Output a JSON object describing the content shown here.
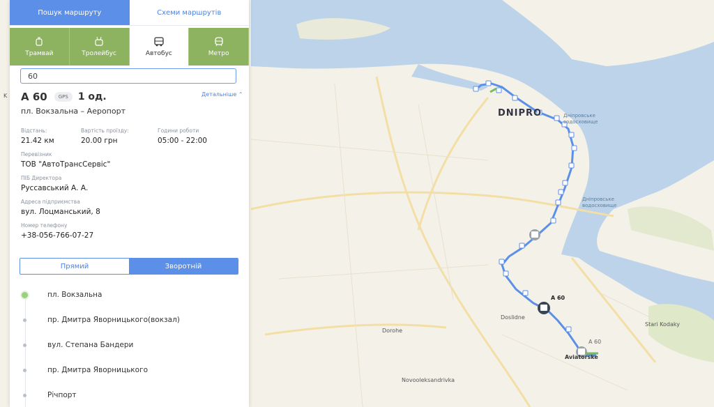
{
  "tabs": {
    "search": "Пошук маршруту",
    "schemes": "Схеми маршрутів"
  },
  "modes": [
    {
      "label": "Трамвай",
      "icon": "tram-icon"
    },
    {
      "label": "Тролейбус",
      "icon": "trolleybus-icon"
    },
    {
      "label": "Автобус",
      "icon": "bus-icon"
    },
    {
      "label": "Метро",
      "icon": "metro-icon"
    }
  ],
  "search": {
    "value": "60"
  },
  "route": {
    "number": "А 60",
    "gps": "GPS",
    "units": "1 од.",
    "details_link": "Детальніше",
    "name": "пл. Вокзальна – Аеропорт",
    "distance_label": "Відстань:",
    "distance": "21.42 км",
    "price_label": "Вартість проїзду:",
    "price": "20.00 грн",
    "hours_label": "Години роботи",
    "hours": "05:00 - 22:00",
    "carrier_label": "Перевізник",
    "carrier": "ТОВ \"АвтоТрансСервіс\"",
    "director_label": "ПІБ Директора",
    "director": "Руссавський А. А.",
    "address_label": "Адреса підприємства",
    "address": "вул. Лоцманський, 8",
    "phone_label": "Номер телефону",
    "phone": "+38-056-766-07-27"
  },
  "direction": {
    "forward": "Прямий",
    "reverse": "Зворотній",
    "active": "reverse"
  },
  "stops": [
    "пл. Вокзальна",
    "пр. Дмитра Яворницького(вокзал)",
    "вул. Степана Бандери",
    "пр. Дмитра Яворницького",
    "Річпорт"
  ],
  "map": {
    "city": "DNIPRO",
    "reservoir_1": "Дніпровське водосховище",
    "reservoir_2": "Дніпровське водосховище",
    "bus_label_1": "А 60",
    "bus_label_2": "А 60",
    "place_dorohe": "Dorohe",
    "place_doslidne": "Doslidne",
    "place_stari_kodaky": "Stari Kodaky",
    "place_aviatorske": "Aviatorske",
    "place_novooleksandrivka": "Novooleksandrivka",
    "place_k": "K",
    "route_color": "#5b8fe8",
    "water_color": "#bcd3ea"
  }
}
